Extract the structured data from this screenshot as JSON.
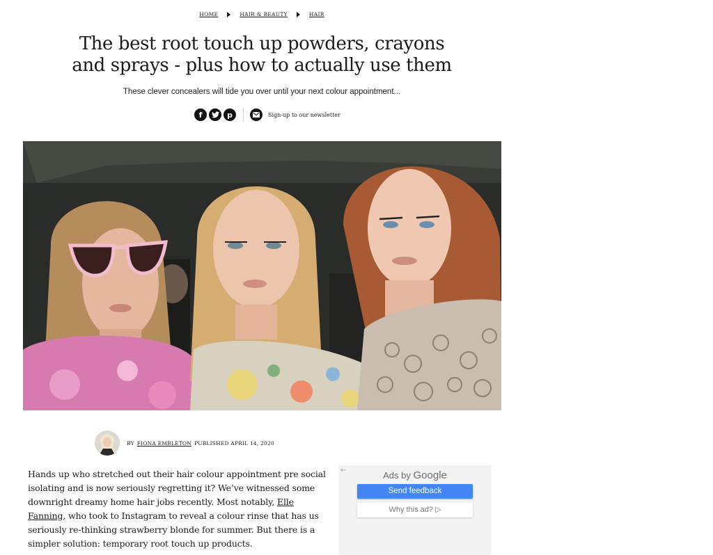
{
  "breadcrumb": {
    "items": [
      "HOME",
      "HAIR & BEAUTY",
      "HAIR"
    ]
  },
  "article": {
    "title": "The best root touch up powders, crayons and sprays - plus how to actually use them",
    "standfirst": "These clever concealers will tide you over until your next colour appointment...",
    "share": {
      "facebook": "f",
      "twitter": "t",
      "pinterest": "p",
      "newsletter_label": "Sign-up to our newsletter"
    },
    "byline": {
      "by": "BY",
      "author": "FIONA EMBLETON",
      "published": "PUBLISHED APRIL 14, 2020"
    },
    "body": {
      "part1": "Hands up who stretched out their hair colour appointment pre social isolating and is now seriously regretting it? We’ve witnessed some downright dreamy home hair jobs recently. Most notably, ",
      "link": "Elle Fanning",
      "part2": ", who took to Instagram to reveal a colour rinse that has us seriously re-thinking strawberry blonde for summer. But there is a simpler solution: temporary root touch up products."
    }
  },
  "ad": {
    "back": "←",
    "ads_by": "Ads by",
    "google": "Google",
    "send_feedback": "Send feedback",
    "why_this_ad": "Why this ad? ▷"
  }
}
